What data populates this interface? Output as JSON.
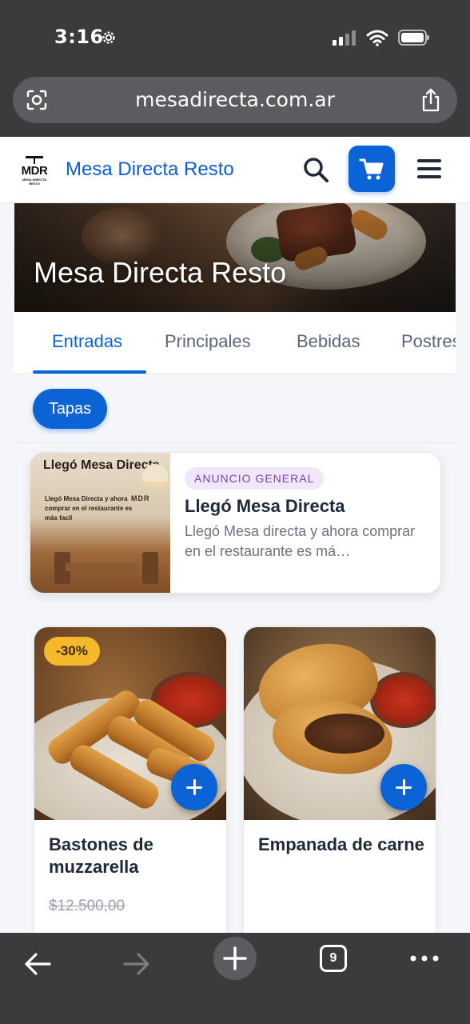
{
  "status_bar": {
    "time": "3:16"
  },
  "browser": {
    "url": "mesadirecta.com.ar",
    "open_tabs_count": "9"
  },
  "header": {
    "logo_text": "MDR",
    "logo_sub": "MESA DIRECTA RESTO",
    "brand_name": "Mesa Directa Resto"
  },
  "hero": {
    "title": "Mesa Directa Resto"
  },
  "tabs": [
    {
      "label": "Entradas",
      "active": true
    },
    {
      "label": "Principales",
      "active": false
    },
    {
      "label": "Bebidas",
      "active": false
    },
    {
      "label": "Postres",
      "active": false
    }
  ],
  "subcategories": [
    {
      "label": "Tapas",
      "active": true
    }
  ],
  "announcement": {
    "badge": "ANUNCIO GENERAL",
    "title": "Llegó Mesa Directa",
    "description": "Llegó Mesa directa y ahora comprar en el restaurante es má…",
    "image_title": "Llegó Mesa Directa",
    "image_text": "Llegó Mesa Directa y ahora comprar en el restaurante es más facil",
    "image_sign": "MDR"
  },
  "products": [
    {
      "name": "Bastones de muzzarella",
      "discount": "-30%",
      "old_price": "$12.500,00"
    },
    {
      "name": "Empanada de carne"
    }
  ],
  "colors": {
    "primary": "#0b63d6",
    "brand_text": "#0b5ed7",
    "discount_badge": "#f5b82a",
    "announcement_badge_bg": "#f1e7fb",
    "announcement_badge_text": "#7a3fb3",
    "browser_chrome": "#3a3b3d"
  },
  "icons": {
    "status": [
      "settings-gear-icon",
      "signal-icon",
      "wifi-icon",
      "battery-icon"
    ],
    "url_bar": [
      "screen-scan-icon",
      "share-icon"
    ],
    "header": [
      "search-icon",
      "cart-icon",
      "hamburger-menu-icon"
    ],
    "bottom_bar": [
      "back-arrow-icon",
      "forward-arrow-icon",
      "plus-icon",
      "tabs-icon",
      "more-dots-icon"
    ]
  }
}
